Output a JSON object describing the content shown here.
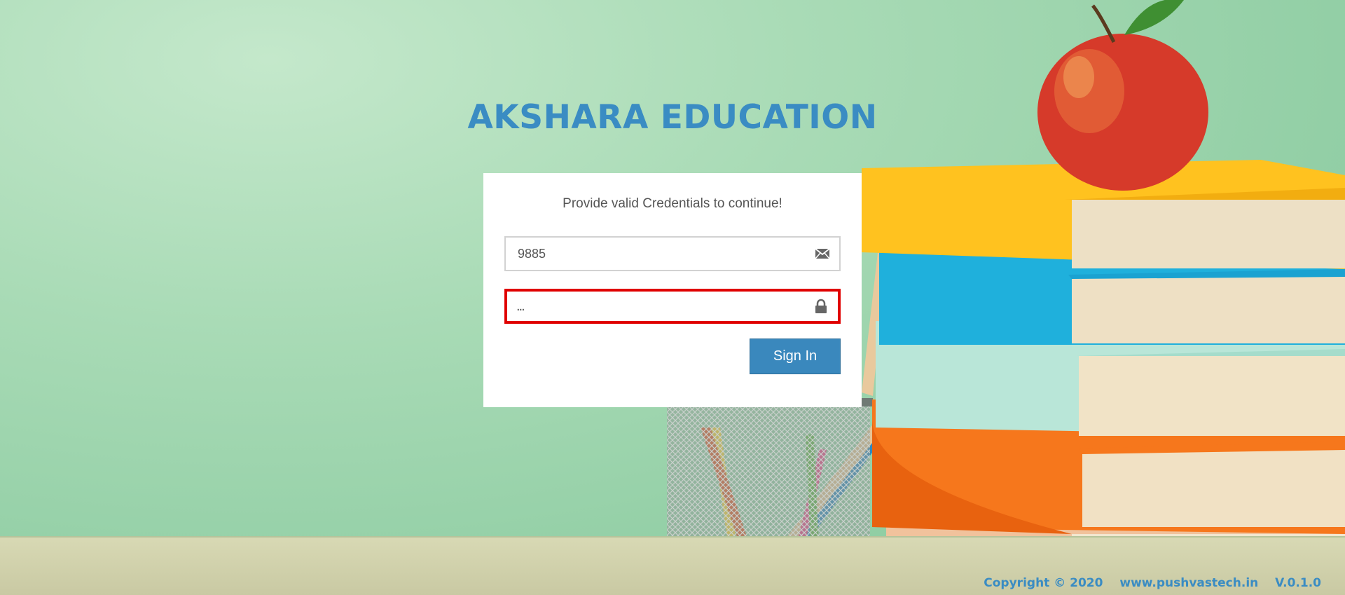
{
  "header": {
    "title": "AKSHARA EDUCATION"
  },
  "login": {
    "message": "Provide valid Credentials to continue!",
    "username": {
      "value": "9885",
      "icon": "envelope-icon"
    },
    "password": {
      "value": "...",
      "icon": "lock-icon"
    },
    "signin_label": "Sign In"
  },
  "footer": {
    "copyright": "Copyright © 2020",
    "website": "www.pushvastech.in",
    "version": "V.0.1.0"
  },
  "colors": {
    "brand": "#3a8cc3",
    "button": "#3a88bd",
    "highlight_border": "#e00000"
  }
}
